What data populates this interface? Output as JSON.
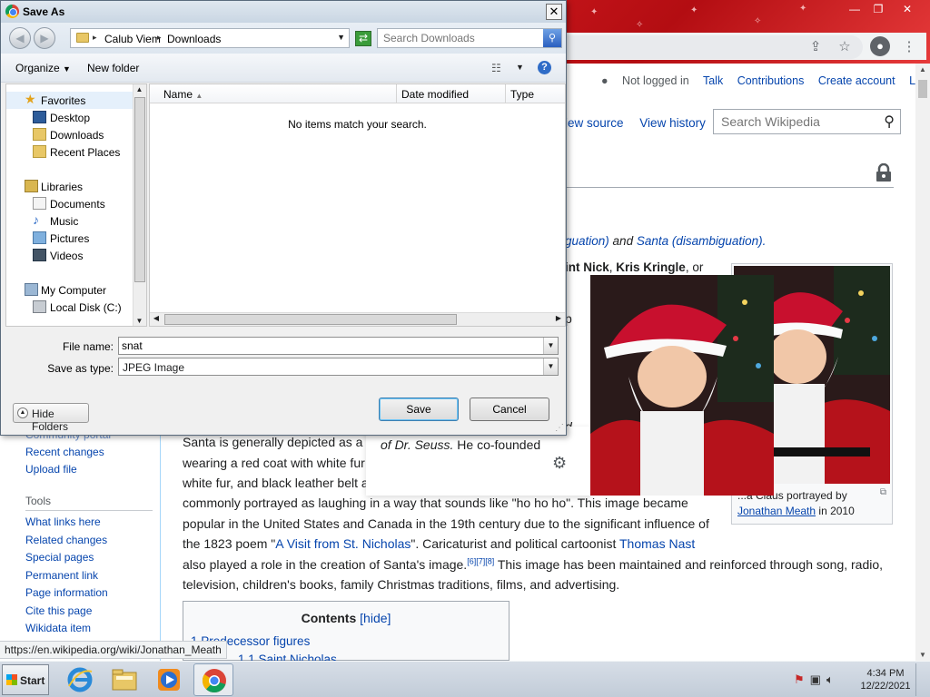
{
  "dialog": {
    "title": "Save As",
    "breadcrumb": [
      "Calub Viem",
      "Downloads"
    ],
    "search_placeholder": "Search Downloads",
    "toolbar": {
      "organize": "Organize",
      "new_folder": "New folder"
    },
    "nav_groups": [
      {
        "label": "Favorites",
        "items": [
          "Desktop",
          "Downloads",
          "Recent Places"
        ]
      },
      {
        "label": "Libraries",
        "items": [
          "Documents",
          "Music",
          "Pictures",
          "Videos"
        ]
      },
      {
        "label": "My Computer",
        "items": [
          "Local Disk (C:)"
        ]
      }
    ],
    "columns": [
      "Name",
      "Date modified",
      "Type"
    ],
    "empty_message": "No items match your search.",
    "file_name_label": "File name:",
    "file_name_value": "snat",
    "save_type_label": "Save as type:",
    "save_type_value": "JPEG Image",
    "save_button": "Save",
    "cancel_button": "Cancel",
    "hide_folders": "Hide Folders"
  },
  "wiki": {
    "user_links": [
      "Not logged in",
      "Talk",
      "Contributions",
      "Create account",
      "Log in"
    ],
    "view_tabs": [
      "iew source",
      "View history"
    ],
    "search_placeholder": "Search Wikipedia",
    "hatnote_a": "guation)",
    "hatnote_and": " and ",
    "hatnote_b": "Santa (disambiguation).",
    "intro_a": "int Nick",
    "intro_sep": ", ",
    "intro_b": "Kris Kringle",
    "intro_c": ", or",
    "intro_p": "p",
    "intro_d": "d",
    "infobox_caption_a": "...a Claus portrayed by",
    "infobox_caption_link": "Jonathan Meath",
    "infobox_caption_b": " in 2010",
    "sidebar_top": [
      "Community portal",
      "Recent changes",
      "Upload file"
    ],
    "tools_heading": "Tools",
    "tools_links": [
      "What links here",
      "Related changes",
      "Special pages",
      "Permanent link",
      "Page information",
      "Cite this page",
      "Wikidata item"
    ],
    "article": {
      "l1": "Santa is generally depicted as a",
      "l2": "wearing a red coat with white fur",
      "l3": "white fur, and black leather belt a",
      "l4": "commonly portrayed as laughing in a way that sounds like \"ho ho ho\". This image became",
      "l5": "popular in the United States and Canada in the 19th century due to the significant influence of",
      "l6a": "the 1823 poem \"",
      "l6link": "A Visit from St. Nicholas",
      "l6b": "\". Caricaturist and political cartoonist ",
      "l6link2": "Thomas Nast",
      "l7a": "also played a role in the creation of Santa's image.",
      "l7sup": "[6][7][8]",
      "l7b": " This image has been maintained and reinforced through song, radio,",
      "l8": "television, children's books, family Christmas traditions, films, and advertising."
    },
    "popup_text_a": "of Dr. Seuss.",
    "popup_text_b": " He co-founded",
    "toc_title": "Contents",
    "toc_hide": "[hide]",
    "toc_item1": "1  Predecessor figures",
    "toc_item2": "1.1 Saint Nicholas"
  },
  "status_url": "https://en.wikipedia.org/wiki/Jonathan_Meath",
  "taskbar": {
    "start": "Start",
    "apps": [
      "internet-explorer",
      "file-explorer",
      "media-player",
      "chrome"
    ],
    "time": "4:34 PM",
    "date": "12/22/2021"
  }
}
